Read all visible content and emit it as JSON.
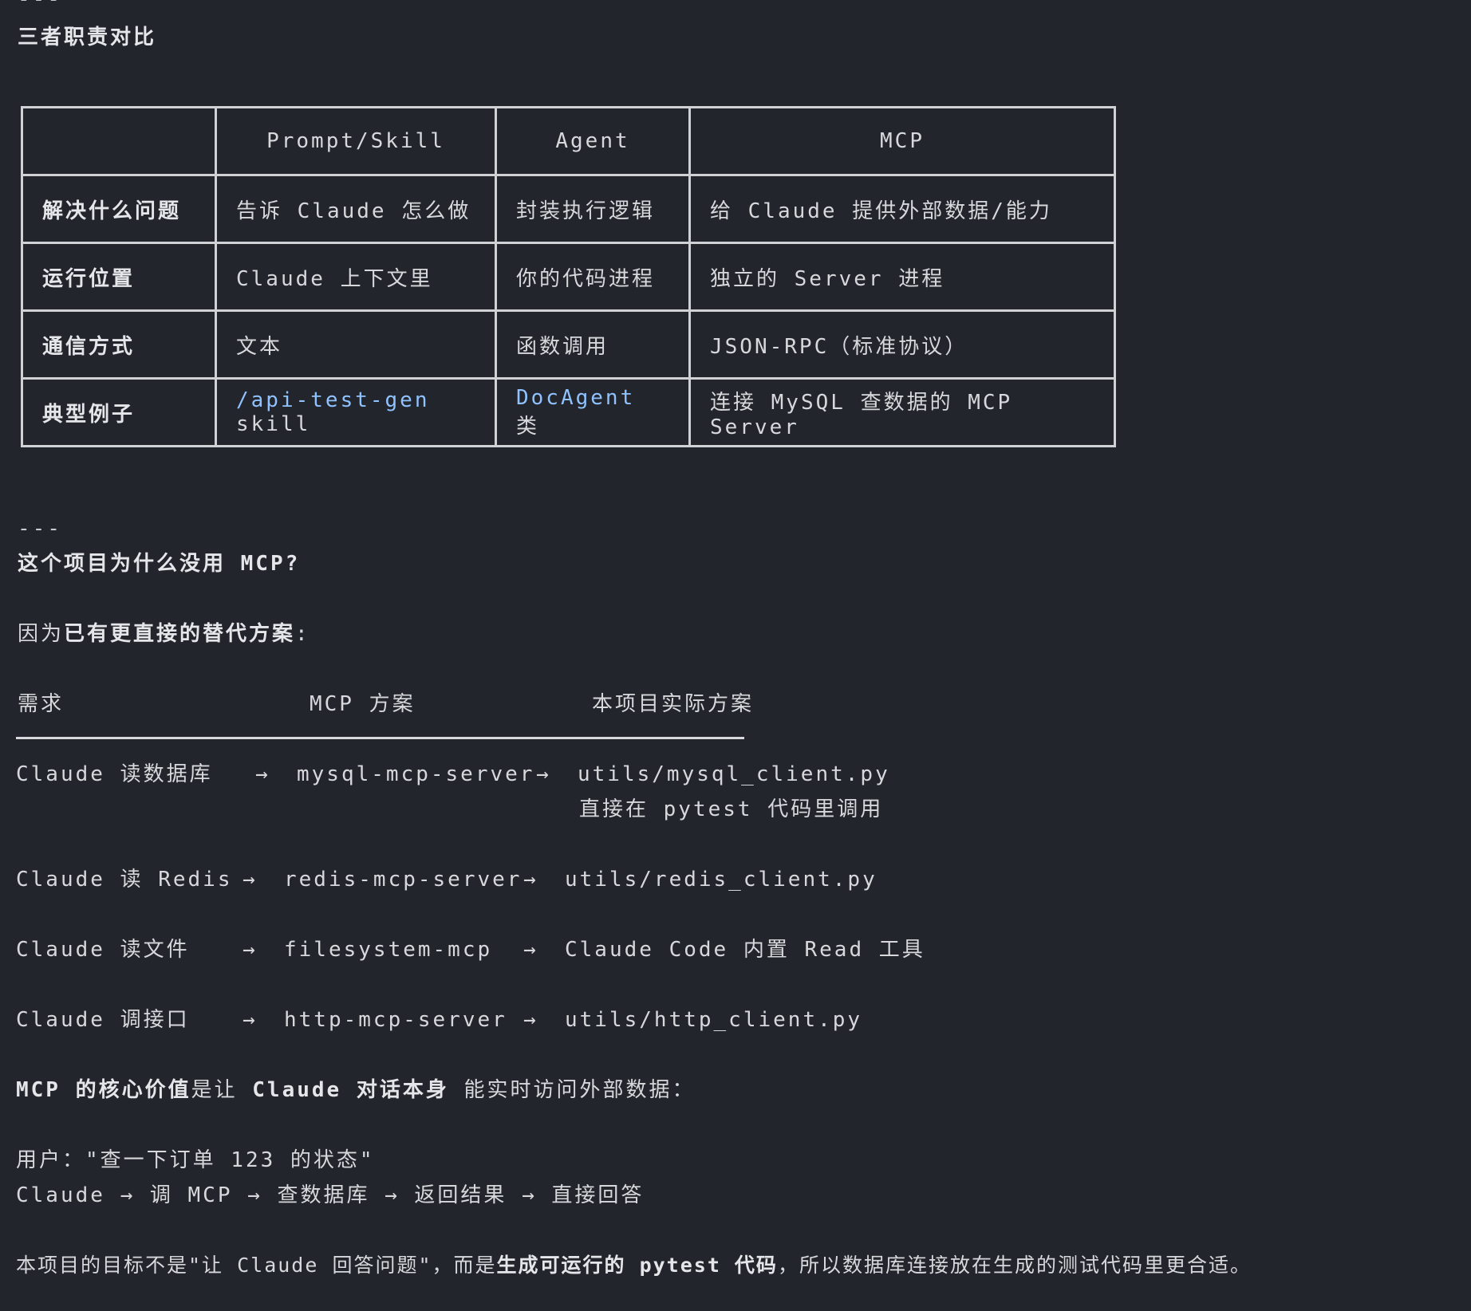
{
  "top_rule": "---",
  "section1": {
    "title": "三者职责对比"
  },
  "table": {
    "headers": [
      "",
      "Prompt/Skill",
      "Agent",
      "MCP"
    ],
    "rows": [
      {
        "label": "解决什么问题",
        "cells": [
          "告诉 Claude 怎么做",
          "封装执行逻辑",
          "给 Claude 提供外部数据/能力"
        ]
      },
      {
        "label": "运行位置",
        "cells": [
          "Claude 上下文里",
          "你的代码进程",
          "独立的 Server 进程"
        ]
      },
      {
        "label": "通信方式",
        "cells": [
          "文本",
          "函数调用",
          "JSON-RPC（标准协议）"
        ]
      },
      {
        "label": "典型例子",
        "cells": [
          {
            "link": "/api-test-gen",
            "text": " skill"
          },
          {
            "link": "DocAgent",
            "text": " 类"
          },
          "连接 MySQL 查数据的 MCP Server"
        ]
      }
    ]
  },
  "divider": "---",
  "section2": {
    "title": "这个项目为什么没用 MCP?",
    "intro_plain": "因为",
    "intro_bold": "已有更直接的替代方案",
    "intro_end": ":",
    "compare_headers": [
      "需求",
      "MCP 方案",
      "本项目实际方案"
    ],
    "compare_rows": [
      {
        "need": "Claude 读数据库",
        "arrow1": "→",
        "mcp": "mysql-mcp-server",
        "arrow2": "→",
        "actual": "utils/mysql_client.py",
        "note": "直接在 pytest 代码里调用"
      },
      {
        "need": "Claude 读 Redis",
        "arrow1": "→",
        "mcp": "redis-mcp-server",
        "arrow2": "→",
        "actual": "utils/redis_client.py"
      },
      {
        "need": "Claude 读文件",
        "arrow1": "→",
        "mcp": "filesystem-mcp",
        "arrow2": "→",
        "actual": "Claude Code 内置 Read 工具"
      },
      {
        "need": "Claude 调接口",
        "arrow1": "→",
        "mcp": "http-mcp-server",
        "arrow2": "→",
        "actual": "utils/http_client.py"
      }
    ],
    "core_bold1": "MCP 的核心价值",
    "core_mid": "是让 ",
    "core_bold2": "Claude 对话本身",
    "core_end": " 能实时访问外部数据：",
    "example_line1": "用户：\"查一下订单 123 的状态\"",
    "example_line2": "Claude → 调 MCP → 查数据库 → 返回结果 → 直接回答",
    "conclusion_plain1": "本项目的目标不是\"让 Claude 回答问题\"，而是",
    "conclusion_bold": "生成可运行的 pytest 代码",
    "conclusion_plain2": "，所以数据库连接放在生成的测试代码里更合适。"
  }
}
